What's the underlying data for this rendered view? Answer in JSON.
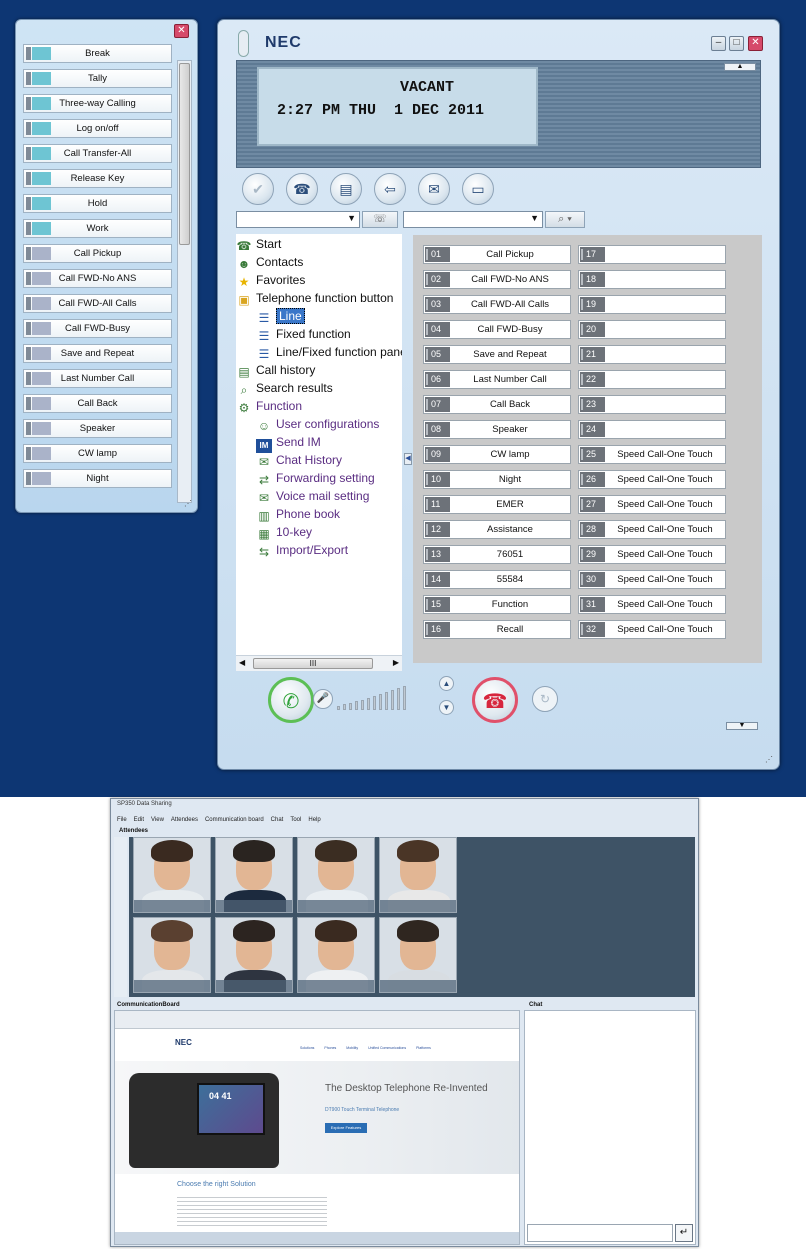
{
  "feature_panel": {
    "close_icon": "close-icon",
    "items": [
      {
        "label": "Break",
        "lamp_color": "#6ec5d3"
      },
      {
        "label": "Tally",
        "lamp_color": "#6ec5d3"
      },
      {
        "label": "Three-way Calling",
        "lamp_color": "#6ec5d3"
      },
      {
        "label": "Log on/off",
        "lamp_color": "#6ec5d3"
      },
      {
        "label": "Call Transfer-All",
        "lamp_color": "#6ec5d3"
      },
      {
        "label": "Release Key",
        "lamp_color": "#6ec5d3"
      },
      {
        "label": "Hold",
        "lamp_color": "#6ec5d3"
      },
      {
        "label": "Work",
        "lamp_color": "#6ec5d3"
      },
      {
        "label": "Call Pickup",
        "lamp_color": "#aab3c9"
      },
      {
        "label": "Call FWD-No ANS",
        "lamp_color": "#aab3c9"
      },
      {
        "label": "Call FWD-All Calls",
        "lamp_color": "#aab3c9"
      },
      {
        "label": "Call FWD-Busy",
        "lamp_color": "#aab3c9"
      },
      {
        "label": "Save and Repeat",
        "lamp_color": "#aab3c9"
      },
      {
        "label": "Last Number Call",
        "lamp_color": "#aab3c9"
      },
      {
        "label": "Call Back",
        "lamp_color": "#aab3c9"
      },
      {
        "label": "Speaker",
        "lamp_color": "#aab3c9"
      },
      {
        "label": "CW lamp",
        "lamp_color": "#aab3c9"
      },
      {
        "label": "Night",
        "lamp_color": "#aab3c9"
      }
    ]
  },
  "phone": {
    "brand": "NEC",
    "lcd": {
      "line1": "VACANT",
      "line2": "2:27 PM THU  1 DEC 2011"
    },
    "tree": [
      {
        "label": "Start",
        "icon": "start-icon",
        "level": 0,
        "kind": "normal"
      },
      {
        "label": "Contacts",
        "icon": "contacts-icon",
        "level": 0,
        "kind": "normal"
      },
      {
        "label": "Favorites",
        "icon": "star-icon",
        "level": 0,
        "kind": "normal"
      },
      {
        "label": "Telephone function button",
        "icon": "folder-icon",
        "level": 0,
        "kind": "normal"
      },
      {
        "label": "Line",
        "icon": "list-icon",
        "level": 1,
        "kind": "selected"
      },
      {
        "label": "Fixed function",
        "icon": "list-icon",
        "level": 1,
        "kind": "normal"
      },
      {
        "label": "Line/Fixed function panel",
        "icon": "list-icon",
        "level": 1,
        "kind": "normal"
      },
      {
        "label": "Call history",
        "icon": "history-icon",
        "level": 0,
        "kind": "normal"
      },
      {
        "label": "Search results",
        "icon": "search-results-icon",
        "level": 0,
        "kind": "normal"
      },
      {
        "label": "Function",
        "icon": "function-icon",
        "level": 0,
        "kind": "func"
      },
      {
        "label": "User configurations",
        "icon": "user-config-icon",
        "level": 1,
        "kind": "func"
      },
      {
        "label": "Send IM",
        "icon": "im-icon",
        "level": 1,
        "kind": "func"
      },
      {
        "label": "Chat History",
        "icon": "chat-icon",
        "level": 1,
        "kind": "func"
      },
      {
        "label": "Forwarding setting",
        "icon": "forward-icon",
        "level": 1,
        "kind": "func"
      },
      {
        "label": "Voice mail setting",
        "icon": "voicemail-icon",
        "level": 1,
        "kind": "func"
      },
      {
        "label": "Phone book",
        "icon": "phonebook-icon",
        "level": 1,
        "kind": "func"
      },
      {
        "label": "10-key",
        "icon": "keypad-icon",
        "level": 1,
        "kind": "func"
      },
      {
        "label": "Import/Export",
        "icon": "import-export-icon",
        "level": 1,
        "kind": "func"
      }
    ],
    "keys_left": [
      {
        "num": "01",
        "label": "Call Pickup"
      },
      {
        "num": "02",
        "label": "Call FWD-No ANS"
      },
      {
        "num": "03",
        "label": "Call FWD-All Calls"
      },
      {
        "num": "04",
        "label": "Call FWD-Busy"
      },
      {
        "num": "05",
        "label": "Save and Repeat"
      },
      {
        "num": "06",
        "label": "Last Number Call"
      },
      {
        "num": "07",
        "label": "Call Back"
      },
      {
        "num": "08",
        "label": "Speaker"
      },
      {
        "num": "09",
        "label": "CW lamp"
      },
      {
        "num": "10",
        "label": "Night"
      },
      {
        "num": "11",
        "label": "EMER"
      },
      {
        "num": "12",
        "label": "Assistance"
      },
      {
        "num": "13",
        "label": "76051"
      },
      {
        "num": "14",
        "label": "55584"
      },
      {
        "num": "15",
        "label": "Function"
      },
      {
        "num": "16",
        "label": "Recall"
      }
    ],
    "keys_right": [
      {
        "num": "17",
        "label": ""
      },
      {
        "num": "18",
        "label": ""
      },
      {
        "num": "19",
        "label": ""
      },
      {
        "num": "20",
        "label": ""
      },
      {
        "num": "21",
        "label": ""
      },
      {
        "num": "22",
        "label": ""
      },
      {
        "num": "23",
        "label": ""
      },
      {
        "num": "24",
        "label": ""
      },
      {
        "num": "25",
        "label": "Speed Call-One Touch"
      },
      {
        "num": "26",
        "label": "Speed Call-One Touch"
      },
      {
        "num": "27",
        "label": "Speed Call-One Touch"
      },
      {
        "num": "28",
        "label": "Speed Call-One Touch"
      },
      {
        "num": "29",
        "label": "Speed Call-One Touch"
      },
      {
        "num": "30",
        "label": "Speed Call-One Touch"
      },
      {
        "num": "31",
        "label": "Speed Call-One Touch"
      },
      {
        "num": "32",
        "label": "Speed Call-One Touch"
      }
    ],
    "scroll_thumb_glyph": "III"
  },
  "sharing": {
    "title": "SP350 Data Sharing",
    "menu": [
      "File",
      "Edit",
      "View",
      "Attendees",
      "Communication board",
      "Chat",
      "Tool",
      "Help"
    ],
    "attendees_label": "Attendees",
    "board_label": "CommunicationBoard",
    "chat_label": "Chat",
    "web": {
      "logo": "NEC",
      "nav": [
        "Solutions",
        "Phones",
        "Mobility",
        "Unified Communications",
        "Platforms"
      ],
      "phone_time": "04 41",
      "headline": "The Desktop Telephone Re-Invented",
      "subhead": "DT900 Touch Terminal Telephone",
      "button": "Explore Features",
      "choose": "Choose the right Solution"
    }
  }
}
